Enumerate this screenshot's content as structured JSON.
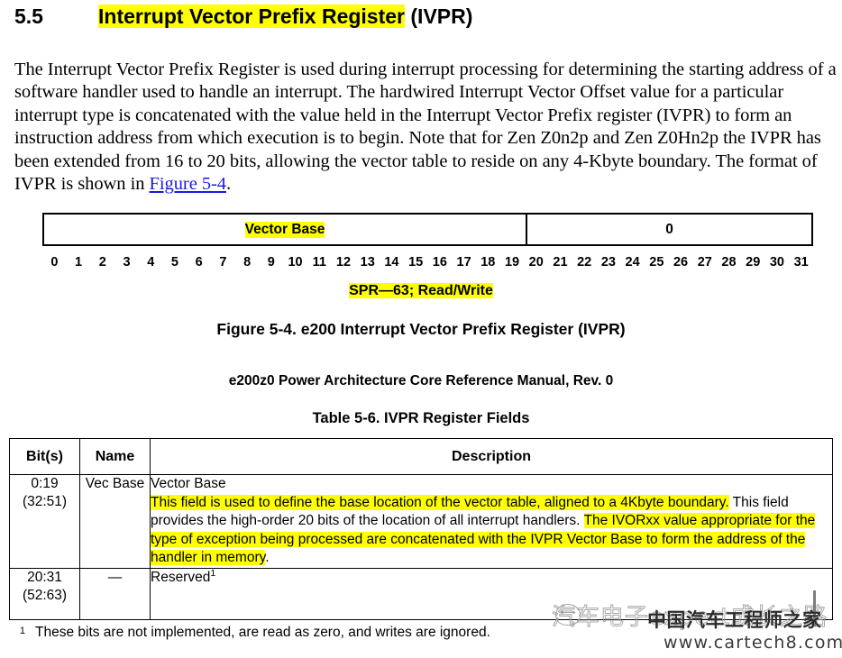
{
  "heading": {
    "number": "5.5",
    "highlighted_title": "Interrupt Vector Prefix Register",
    "suffix": " (IVPR)"
  },
  "paragraph": {
    "part1": "The Interrupt Vector Prefix Register is used during interrupt processing for determining the starting address of a software handler used to handle an interrupt. The hardwired Interrupt Vector Offset value for a particular interrupt type is concatenated with the value held in the Interrupt Vector Prefix register (IVPR) to form an instruction address from which execution is to begin. Note that for Zen Z0n2p and Zen Z0Hn2p the IVPR has been extended from 16 to 20 bits, allowing the vector table to reside on any 4-Kbyte boundary. The format of IVPR is shown in ",
    "link_text": "Figure 5-4",
    "part2": "."
  },
  "register_diagram": {
    "field_left_label": "Vector Base",
    "field_right_label": "0",
    "bit_numbers": [
      "0",
      "1",
      "2",
      "3",
      "4",
      "5",
      "6",
      "7",
      "8",
      "9",
      "10",
      "11",
      "12",
      "13",
      "14",
      "15",
      "16",
      "17",
      "18",
      "19",
      "20",
      "21",
      "22",
      "23",
      "24",
      "25",
      "26",
      "27",
      "28",
      "29",
      "30",
      "31"
    ],
    "spr_note": "SPR—63; Read/Write",
    "highlight_color": "#ffff00"
  },
  "captions": {
    "figure": "Figure 5-4. e200 Interrupt Vector Prefix Register (IVPR)",
    "manual": "e200z0 Power Architecture Core Reference Manual,  Rev. 0",
    "table": "Table 5-6. IVPR Register Fields"
  },
  "table": {
    "headers": [
      "Bit(s)",
      "Name",
      "Description"
    ],
    "rows": [
      {
        "bits": "0:19\n(32:51)",
        "name": "Vec Base",
        "desc_title": "Vector Base",
        "desc_seg1_highlighted": "This field is used to define the base location of the vector table, aligned to a 4Kbyte boundary.",
        "desc_seg2_plain": " This field provides the high-order 20 bits of the location of all interrupt handlers. ",
        "desc_seg3_highlighted": "The IVORxx  value appropriate for the type of exception being processed are concatenated with the IVPR Vector Base to form the address of the handler in memory",
        "desc_seg4_plain": "."
      },
      {
        "bits": "20:31\n(52:63)",
        "name": "—",
        "desc_title": "Reserved",
        "desc_superscript": "1"
      }
    ]
  },
  "footnote": {
    "marker": "1",
    "text": "These bits are not implemented, are read as zero, and writes are ignored."
  },
  "watermarks": {
    "outline_text": "汽车电子expert成长之路",
    "dark_text": "中国汽车工程师之家",
    "url_text": "www.cartech8.com"
  }
}
